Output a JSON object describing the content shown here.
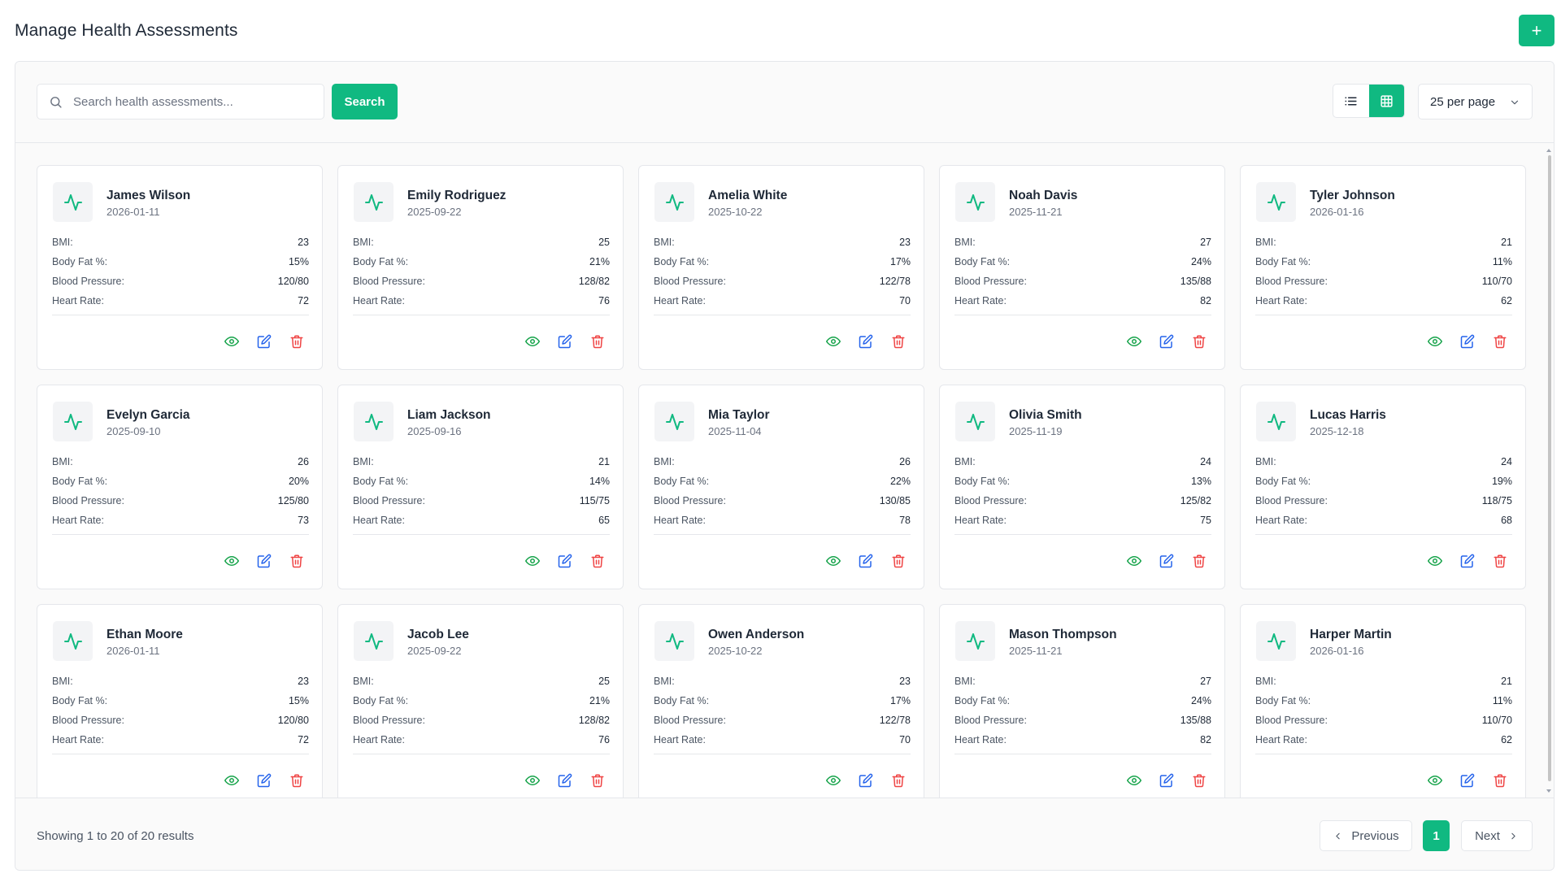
{
  "header": {
    "title": "Manage Health Assessments",
    "add_label": "+"
  },
  "toolbar": {
    "search_placeholder": "Search health assessments...",
    "search_value": "",
    "search_button": "Search",
    "per_page": "25 per page"
  },
  "metric_labels": {
    "bmi": "BMI:",
    "body_fat": "Body Fat %:",
    "blood_pressure": "Blood Pressure:",
    "heart_rate": "Heart Rate:"
  },
  "colors": {
    "accent": "#10b981",
    "view": "#16a34a",
    "edit": "#2563eb",
    "delete": "#ef4444"
  },
  "cards": [
    {
      "name": "James Wilson",
      "date": "2026-01-11",
      "bmi": "23",
      "body_fat": "15%",
      "blood_pressure": "120/80",
      "heart_rate": "72"
    },
    {
      "name": "Emily Rodriguez",
      "date": "2025-09-22",
      "bmi": "25",
      "body_fat": "21%",
      "blood_pressure": "128/82",
      "heart_rate": "76"
    },
    {
      "name": "Amelia White",
      "date": "2025-10-22",
      "bmi": "23",
      "body_fat": "17%",
      "blood_pressure": "122/78",
      "heart_rate": "70"
    },
    {
      "name": "Noah Davis",
      "date": "2025-11-21",
      "bmi": "27",
      "body_fat": "24%",
      "blood_pressure": "135/88",
      "heart_rate": "82"
    },
    {
      "name": "Tyler Johnson",
      "date": "2026-01-16",
      "bmi": "21",
      "body_fat": "11%",
      "blood_pressure": "110/70",
      "heart_rate": "62"
    },
    {
      "name": "Evelyn Garcia",
      "date": "2025-09-10",
      "bmi": "26",
      "body_fat": "20%",
      "blood_pressure": "125/80",
      "heart_rate": "73"
    },
    {
      "name": "Liam Jackson",
      "date": "2025-09-16",
      "bmi": "21",
      "body_fat": "14%",
      "blood_pressure": "115/75",
      "heart_rate": "65"
    },
    {
      "name": "Mia Taylor",
      "date": "2025-11-04",
      "bmi": "26",
      "body_fat": "22%",
      "blood_pressure": "130/85",
      "heart_rate": "78"
    },
    {
      "name": "Olivia Smith",
      "date": "2025-11-19",
      "bmi": "24",
      "body_fat": "13%",
      "blood_pressure": "125/82",
      "heart_rate": "75"
    },
    {
      "name": "Lucas Harris",
      "date": "2025-12-18",
      "bmi": "24",
      "body_fat": "19%",
      "blood_pressure": "118/75",
      "heart_rate": "68"
    },
    {
      "name": "Ethan Moore",
      "date": "2026-01-11",
      "bmi": "23",
      "body_fat": "15%",
      "blood_pressure": "120/80",
      "heart_rate": "72"
    },
    {
      "name": "Jacob Lee",
      "date": "2025-09-22",
      "bmi": "25",
      "body_fat": "21%",
      "blood_pressure": "128/82",
      "heart_rate": "76"
    },
    {
      "name": "Owen Anderson",
      "date": "2025-10-22",
      "bmi": "23",
      "body_fat": "17%",
      "blood_pressure": "122/78",
      "heart_rate": "70"
    },
    {
      "name": "Mason Thompson",
      "date": "2025-11-21",
      "bmi": "27",
      "body_fat": "24%",
      "blood_pressure": "135/88",
      "heart_rate": "82"
    },
    {
      "name": "Harper Martin",
      "date": "2026-01-16",
      "bmi": "21",
      "body_fat": "11%",
      "blood_pressure": "110/70",
      "heart_rate": "62"
    }
  ],
  "footer": {
    "results": "Showing 1 to 20 of 20 results",
    "previous": "Previous",
    "current_page": "1",
    "next": "Next"
  }
}
